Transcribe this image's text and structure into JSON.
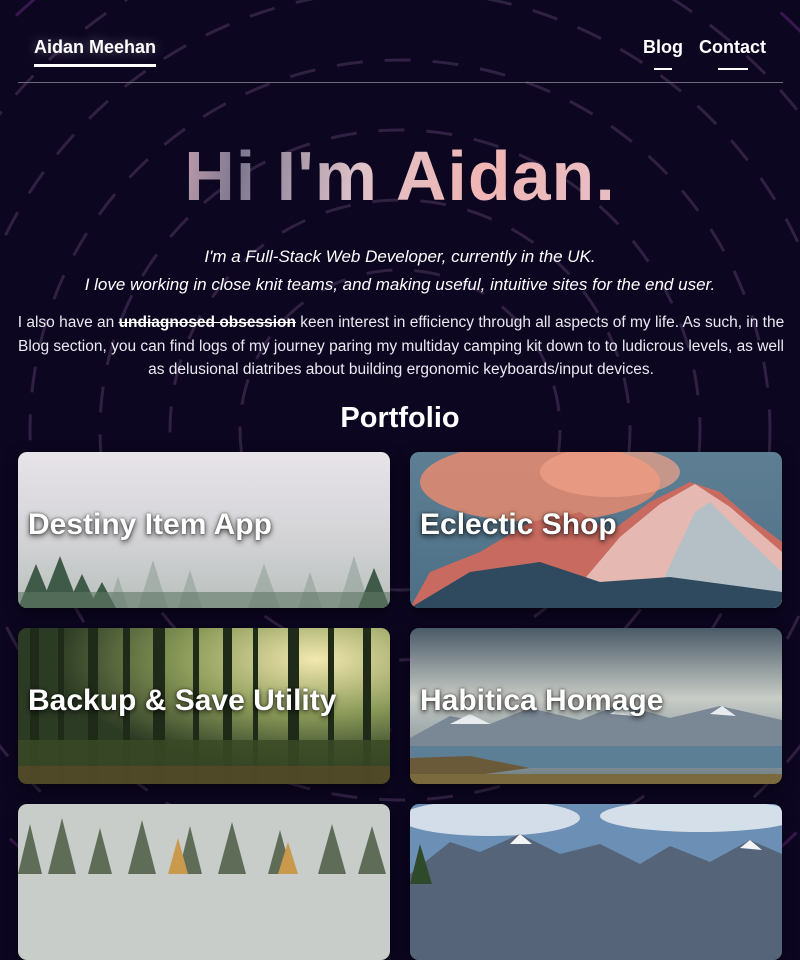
{
  "header": {
    "brand": "Aidan Meehan",
    "nav": [
      {
        "label": "Blog"
      },
      {
        "label": "Contact"
      }
    ]
  },
  "hero": {
    "title": "Hi I'm Aidan.",
    "lead_line1": "I'm a Full-Stack Web Developer, currently in the UK.",
    "lead_line2": "I love working in close knit teams, and making useful, intuitive sites for the end user.",
    "about_prefix": "I also have an ",
    "about_strike": "undiagnosed obsession",
    "about_suffix": " keen interest in efficiency through all aspects of my life. As such, in the Blog section, you can find logs of my journey paring my multiday camping kit down to to ludicrous levels, as well as delusional diatribes about building ergonomic keyboards/input devices."
  },
  "portfolio": {
    "title": "Portfolio",
    "projects": [
      {
        "title": "Destiny Item App"
      },
      {
        "title": "Eclectic Shop"
      },
      {
        "title": "Backup & Save Utility"
      },
      {
        "title": "Habitica Homage"
      },
      {
        "title": ""
      },
      {
        "title": ""
      }
    ]
  },
  "colors": {
    "background": "#0c0620",
    "ring": "#3a2a50",
    "text": "#ffffff"
  }
}
